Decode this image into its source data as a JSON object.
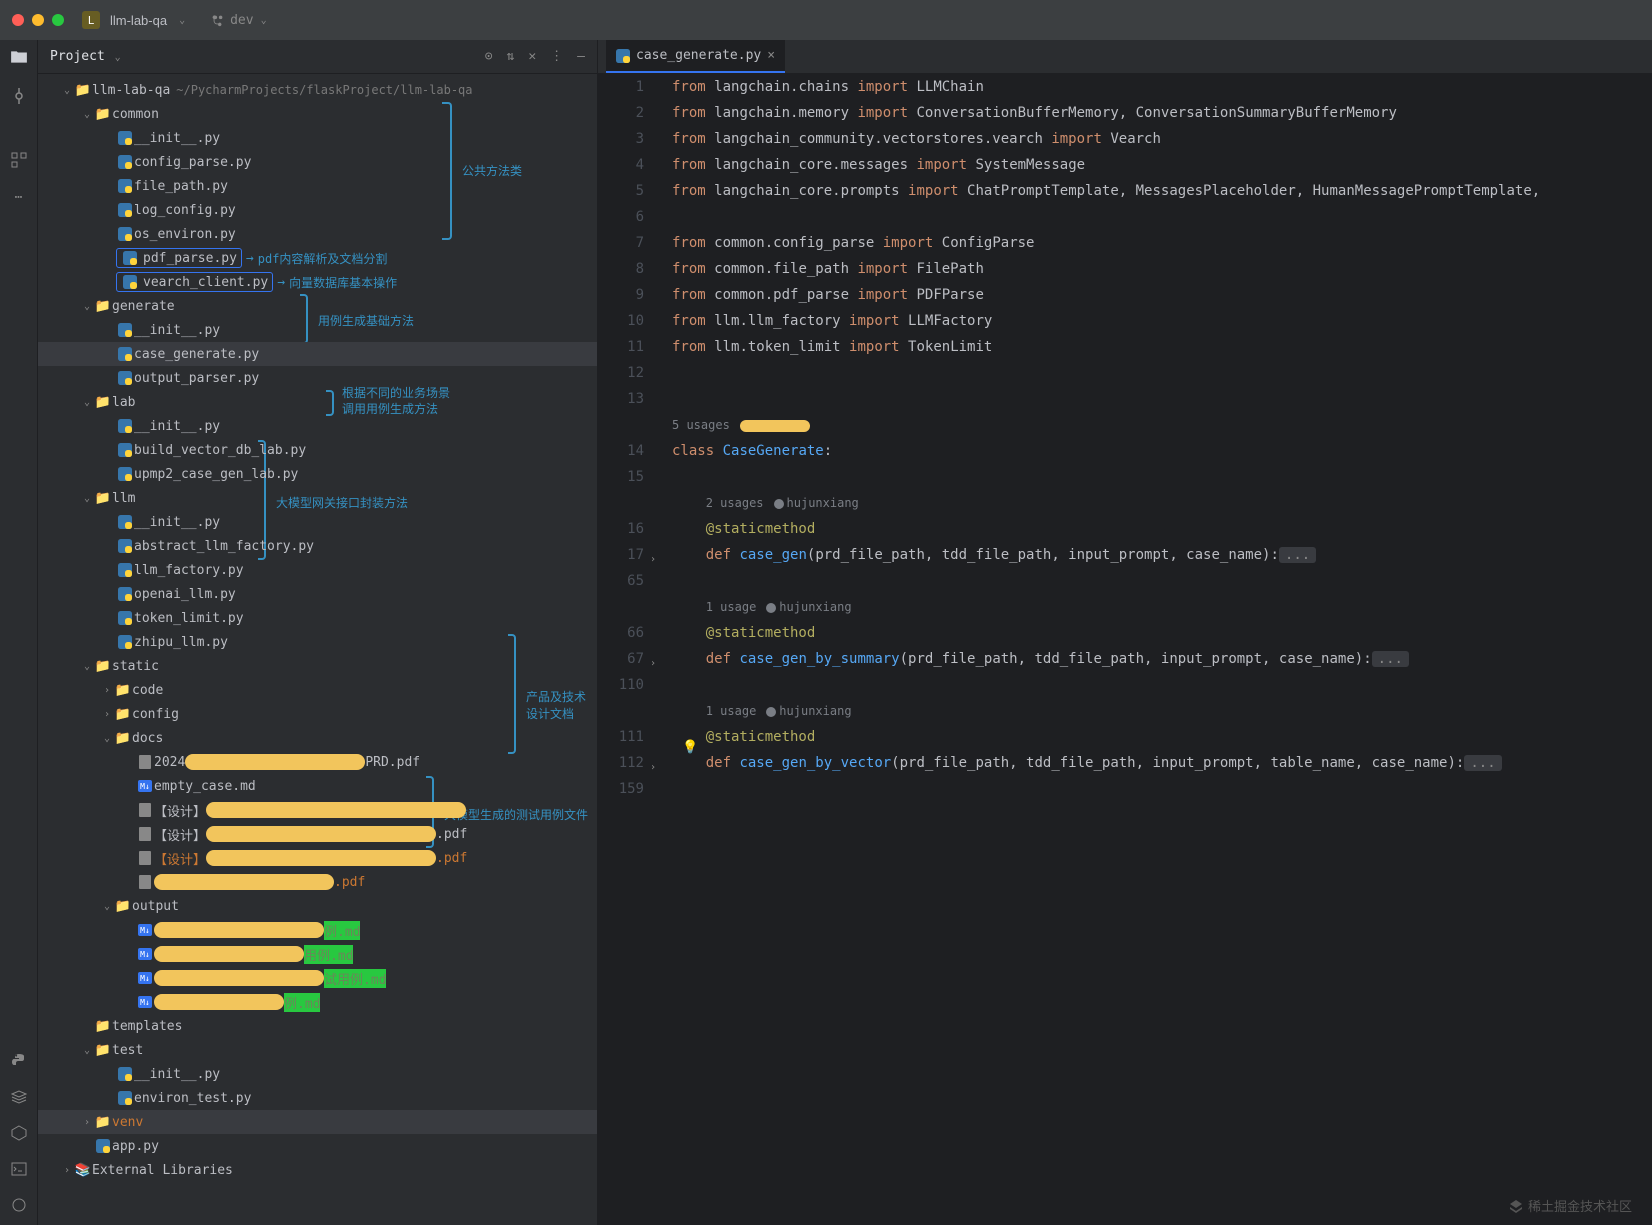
{
  "titlebar": {
    "project_badge": "L",
    "project_name": "llm-lab-qa",
    "branch_name": "dev"
  },
  "panel": {
    "title": "Project",
    "root_name": "llm-lab-qa",
    "root_path": "~/PycharmProjects/flaskProject/llm-lab-qa"
  },
  "annotations": {
    "common": "公共方法类",
    "pdf_parse": "pdf内容解析及文档分割",
    "vearch": "向量数据库基本操作",
    "generate": "用例生成基础方法",
    "lab": "根据不同的业务场景调用用例生成方法",
    "llm": "大模型网关接口封装方法",
    "docs": "产品及技术设计文档",
    "output": "大模型生成的测试用例文件"
  },
  "tree": {
    "common": {
      "name": "common",
      "files": [
        "__init__.py",
        "config_parse.py",
        "file_path.py",
        "log_config.py",
        "os_environ.py",
        "pdf_parse.py",
        "vearch_client.py"
      ]
    },
    "generate": {
      "name": "generate",
      "files": [
        "__init__.py",
        "case_generate.py",
        "output_parser.py"
      ]
    },
    "lab": {
      "name": "lab",
      "files": [
        "__init__.py",
        "build_vector_db_lab.py",
        "upmp2_case_gen_lab.py"
      ]
    },
    "llm": {
      "name": "llm",
      "files": [
        "__init__.py",
        "abstract_llm_factory.py",
        "llm_factory.py",
        "openai_llm.py",
        "token_limit.py",
        "zhipu_llm.py"
      ]
    },
    "static": {
      "name": "static",
      "folders": [
        "code",
        "config",
        "docs",
        "output"
      ]
    },
    "docs_files": [
      "2024",
      "empty_case.md",
      "【设计】",
      "【设计】",
      "【设计】",
      ""
    ],
    "docs_suffix": [
      "PRD.pdf",
      "",
      "",
      ".pdf",
      ".pdf",
      ".pdf"
    ],
    "output_files": [
      "例.md",
      "用例.md",
      "试用例.md",
      "例.md"
    ],
    "templates": "templates",
    "test": {
      "name": "test",
      "files": [
        "__init__.py",
        "environ_test.py"
      ]
    },
    "venv": "venv",
    "app": "app.py",
    "ext": "External Libraries"
  },
  "editor": {
    "tab_name": "case_generate.py",
    "code": {
      "l1": {
        "kw1": "from",
        "mod": "langchain.chains",
        "kw2": "import",
        "imp": "LLMChain"
      },
      "l2": {
        "kw1": "from",
        "mod": "langchain.memory",
        "kw2": "import",
        "imp": "ConversationBufferMemory, ConversationSummaryBufferMemory"
      },
      "l3": {
        "kw1": "from",
        "mod": "langchain_community.vectorstores.vearch",
        "kw2": "import",
        "imp": "Vearch"
      },
      "l4": {
        "kw1": "from",
        "mod": "langchain_core.messages",
        "kw2": "import",
        "imp": "SystemMessage"
      },
      "l5": {
        "kw1": "from",
        "mod": "langchain_core.prompts",
        "kw2": "import",
        "imp": "ChatPromptTemplate, MessagesPlaceholder, HumanMessagePromptTemplate, "
      },
      "l7": {
        "kw1": "from",
        "mod": "common.config_parse",
        "kw2": "import",
        "imp": "ConfigParse"
      },
      "l8": {
        "kw1": "from",
        "mod": "common.file_path",
        "kw2": "import",
        "imp": "FilePath"
      },
      "l9": {
        "kw1": "from",
        "mod": "common.pdf_parse",
        "kw2": "import",
        "imp": "PDFParse"
      },
      "l10": {
        "kw1": "from",
        "mod": "llm.llm_factory",
        "kw2": "import",
        "imp": "LLMFactory"
      },
      "l11": {
        "kw1": "from",
        "mod": "llm.token_limit",
        "kw2": "import",
        "imp": "TokenLimit"
      },
      "usages_class": "5 usages",
      "l14": {
        "kw": "class",
        "name": "CaseGenerate"
      },
      "usages_m1": "2 usages",
      "author": "hujunxiang",
      "decorator": "@staticmethod",
      "l17": {
        "kw": "def",
        "name": "case_gen",
        "params": "(prd_file_path, tdd_file_path, input_prompt, case_name)"
      },
      "usages_m2": "1 usage",
      "l67": {
        "kw": "def",
        "name": "case_gen_by_summary",
        "params": "(prd_file_path, tdd_file_path, input_prompt, case_name)"
      },
      "usages_m3": "1 usage",
      "l112": {
        "kw": "def",
        "name": "case_gen_by_vector",
        "params": "(prd_file_path, tdd_file_path, input_prompt, table_name, case_name)"
      },
      "ellipsis": "..."
    },
    "line_numbers": [
      "1",
      "2",
      "3",
      "4",
      "5",
      "6",
      "7",
      "8",
      "9",
      "10",
      "11",
      "12",
      "13",
      "",
      "14",
      "15",
      "",
      "16",
      "17",
      "65",
      "",
      "66",
      "67",
      "110",
      "",
      "111",
      "112",
      "159"
    ]
  },
  "watermark": "稀土掘金技术社区"
}
